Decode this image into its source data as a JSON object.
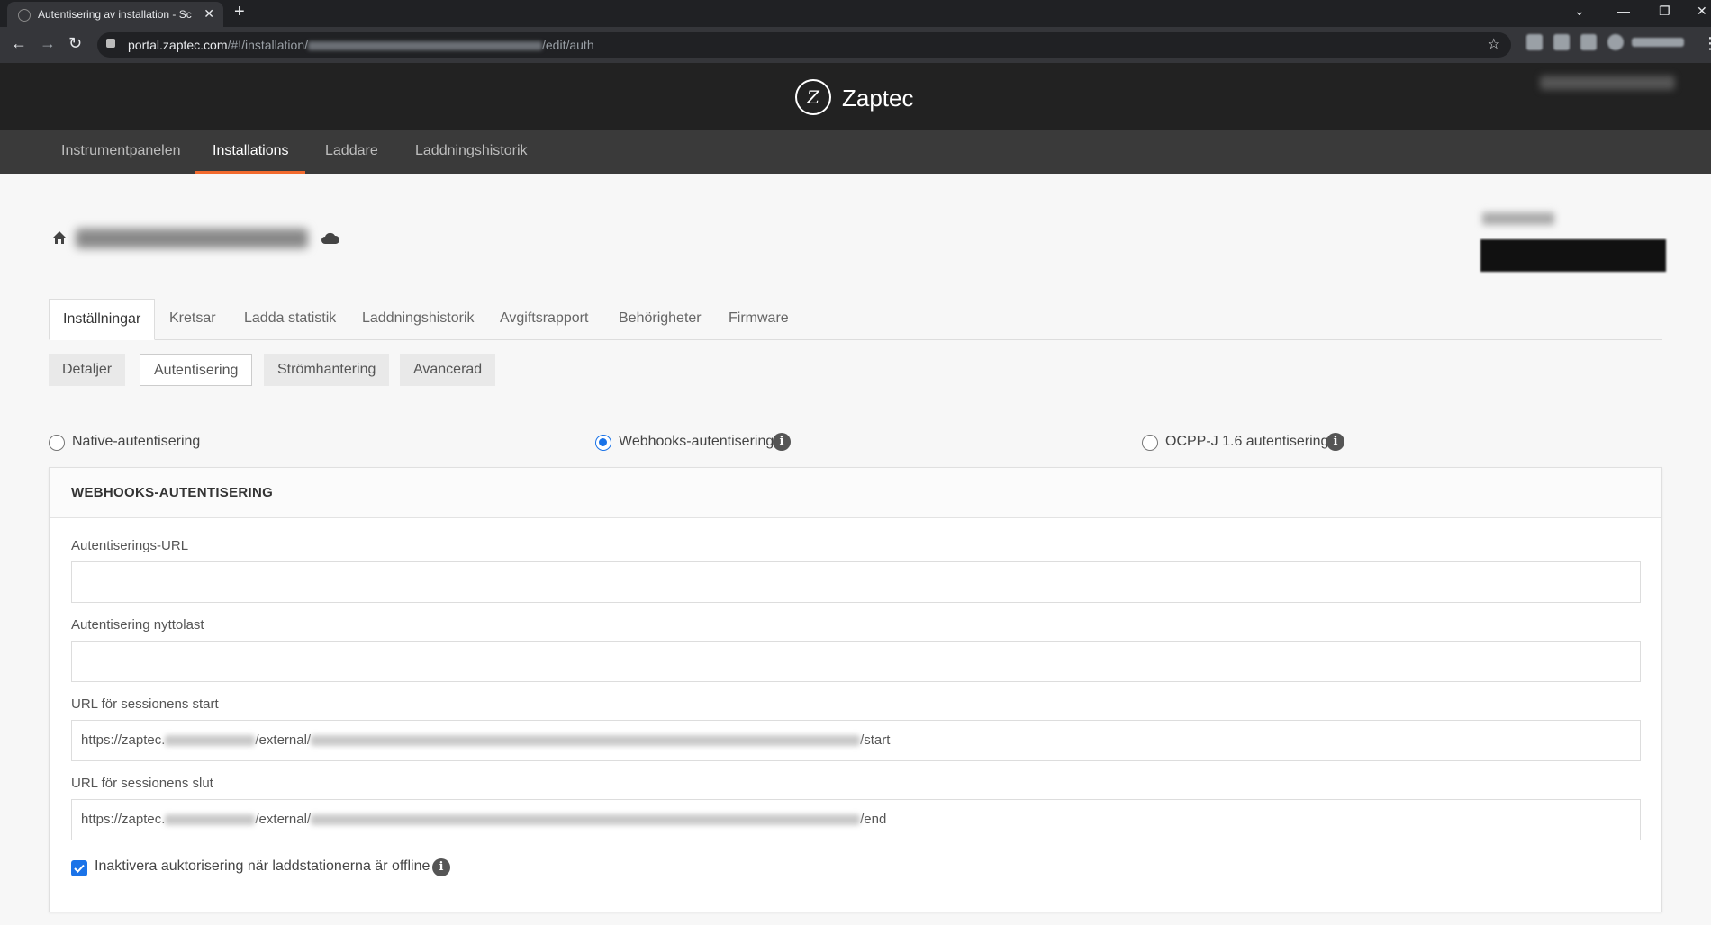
{
  "browser": {
    "tab_title": "Autentisering av installation - Sc",
    "url_host": "portal.zaptec.com",
    "url_path_start": "/#!/installation/",
    "url_path_end": "/edit/auth"
  },
  "app": {
    "brand": "Zaptec"
  },
  "main_nav": {
    "items": [
      {
        "label": "Instrumentpanelen"
      },
      {
        "label": "Installations"
      },
      {
        "label": "Laddare"
      },
      {
        "label": "Laddningshistorik"
      }
    ],
    "active": "Installations"
  },
  "tabs": {
    "items": [
      {
        "label": "Inställningar"
      },
      {
        "label": "Kretsar"
      },
      {
        "label": "Ladda statistik"
      },
      {
        "label": "Laddningshistorik"
      },
      {
        "label": "Avgiftsrapport"
      },
      {
        "label": "Behörigheter"
      },
      {
        "label": "Firmware"
      }
    ],
    "active": "Inställningar"
  },
  "subtabs": {
    "items": [
      {
        "label": "Detaljer"
      },
      {
        "label": "Autentisering"
      },
      {
        "label": "Strömhantering"
      },
      {
        "label": "Avancerad"
      }
    ],
    "active": "Autentisering"
  },
  "auth_options": {
    "native": "Native-autentisering",
    "webhooks": "Webhooks-autentisering",
    "ocpp": "OCPP-J 1.6 autentisering",
    "selected": "webhooks"
  },
  "panel": {
    "title": "WEBHOOKS-AUTENTISERING",
    "fields": [
      {
        "label": "Autentiserings-URL",
        "value": ""
      },
      {
        "label": "Autentisering nyttolast",
        "value": ""
      },
      {
        "label": "URL för sessionens start",
        "prefix": "https://zaptec.",
        "middle": "/external/",
        "suffix": "/start"
      },
      {
        "label": "URL för sessionens slut",
        "prefix": "https://zaptec.",
        "middle": "/external/",
        "suffix": "/end"
      }
    ],
    "checkbox_label": "Inaktivera auktorisering när laddstationerna är offline",
    "checkbox_checked": true
  },
  "colors": {
    "accent": "#f26a2e",
    "header_bg": "#222222",
    "nav_bg": "#3a3a3a",
    "radio_blue": "#1a73e8"
  },
  "icons": [
    "home-icon",
    "cloud-icon",
    "info-icon",
    "lock-icon",
    "star-icon",
    "check-icon"
  ]
}
